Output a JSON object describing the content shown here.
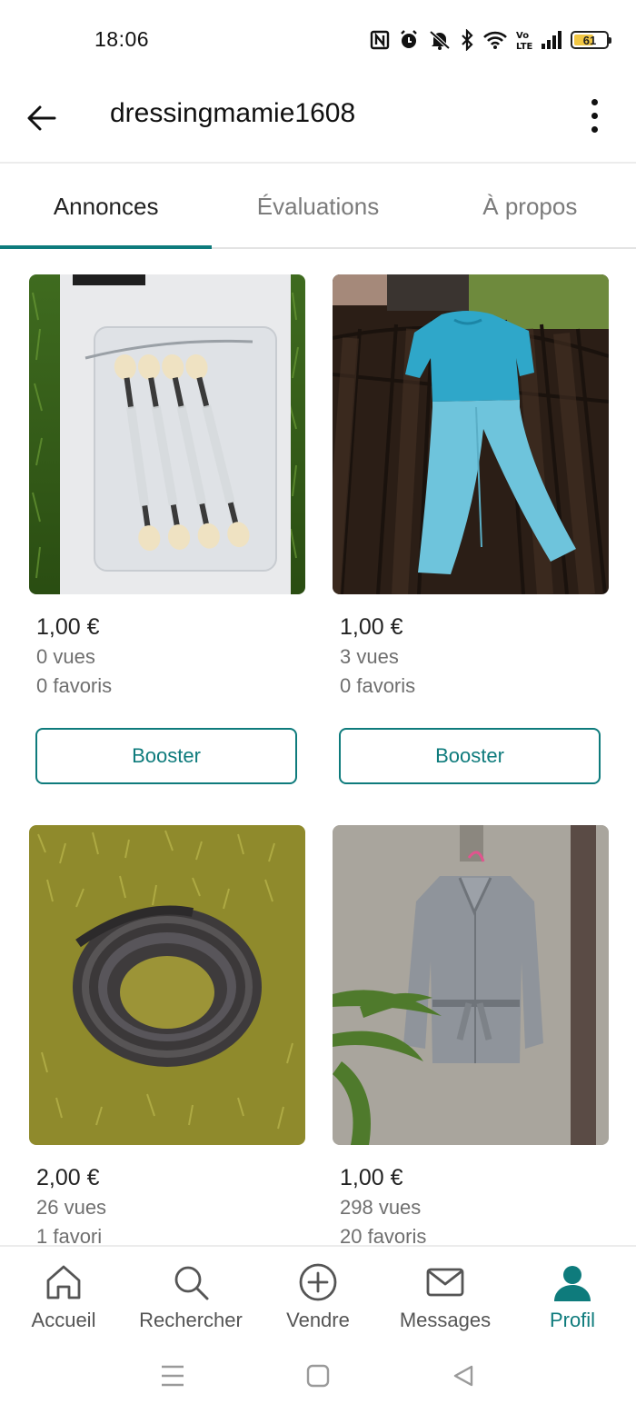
{
  "status_bar": {
    "time": "18:06",
    "battery_level": "61",
    "battery_fraction": 0.61,
    "icons": [
      "nfc-icon",
      "alarm-icon",
      "mute-icon",
      "bluetooth-icon",
      "wifi-icon",
      "volte-icon",
      "signal-icon",
      "battery-icon"
    ]
  },
  "header": {
    "title": "dressingmamie1608"
  },
  "tabs": [
    {
      "label": "Annonces",
      "active": true
    },
    {
      "label": "Évaluations",
      "active": false
    },
    {
      "label": "À propos",
      "active": false
    }
  ],
  "listings": [
    {
      "price": "1,00 €",
      "views": "0 vues",
      "favorites": "0 favoris",
      "button": "Booster",
      "photo": "eyeshadow-applicators"
    },
    {
      "price": "1,00 €",
      "views": "3 vues",
      "favorites": "0 favoris",
      "button": "Booster",
      "photo": "blue-pyjama-set"
    },
    {
      "price": "2,00 €",
      "views": "26 vues",
      "favorites": "1 favori",
      "photo": "rolled-belt"
    },
    {
      "price": "1,00 €",
      "views": "298 vues",
      "favorites": "20 favoris",
      "photo": "grey-jacket"
    }
  ],
  "bottom_nav": [
    {
      "label": "Accueil",
      "icon": "home-icon",
      "active": false
    },
    {
      "label": "Rechercher",
      "icon": "search-icon",
      "active": false
    },
    {
      "label": "Vendre",
      "icon": "plus-circle-icon",
      "active": false
    },
    {
      "label": "Messages",
      "icon": "mail-icon",
      "active": false
    },
    {
      "label": "Profil",
      "icon": "profile-icon",
      "active": true
    }
  ],
  "colors": {
    "accent": "#0e7b7c",
    "text_primary": "#222222",
    "text_secondary": "#6f6f6f"
  }
}
